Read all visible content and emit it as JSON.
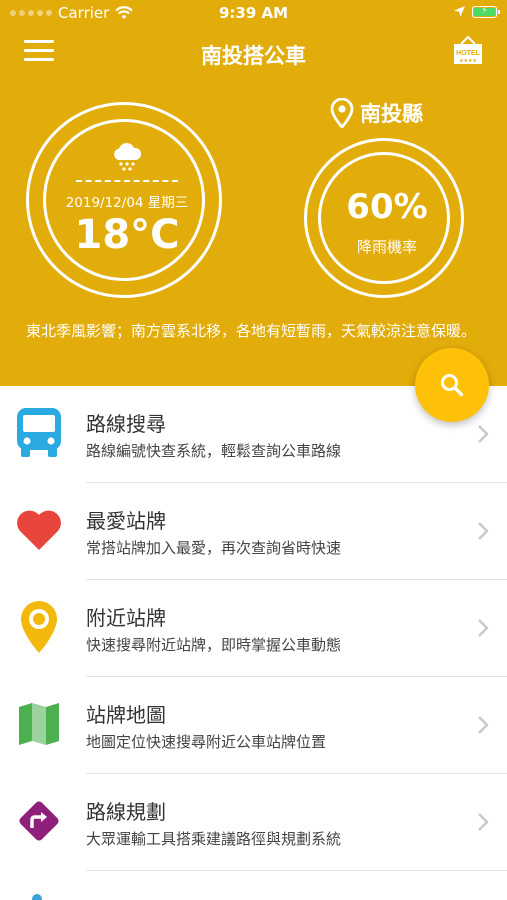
{
  "status_bar": {
    "carrier": "Carrier",
    "time": "9:39 AM"
  },
  "header": {
    "title": "南投搭公車",
    "hotel_icon": "hotel-sign-icon"
  },
  "weather": {
    "date": "2019/12/04 星期三",
    "temperature": "18°C",
    "icon": "rain-cloud-icon"
  },
  "location": {
    "name": "南投縣",
    "icon": "location-pin-icon"
  },
  "rain": {
    "percent": "60%",
    "label": "降雨機率"
  },
  "forecast_text": "東北季風影響；南方雲系北移，各地有短暫雨，天氣較涼注意保暖。",
  "search_button": {
    "icon": "search-icon"
  },
  "menu": [
    {
      "title": "路線搜尋",
      "desc": "路線編號快查系統，輕鬆查詢公車路線",
      "icon": "bus-icon",
      "color": "#29ABE2"
    },
    {
      "title": "最愛站牌",
      "desc": "常搭站牌加入最愛，再次查詢省時快速",
      "icon": "heart-icon",
      "color": "#E8453C"
    },
    {
      "title": "附近站牌",
      "desc": "快速搜尋附近站牌，即時掌握公車動態",
      "icon": "location-pin-icon",
      "color": "#F2B90C"
    },
    {
      "title": "站牌地圖",
      "desc": "地圖定位快速搜尋附近公車站牌位置",
      "icon": "map-icon",
      "color": "#4CAF50"
    },
    {
      "title": "路線規劃",
      "desc": "大眾運輸工具搭乘建議路徑與規劃系統",
      "icon": "route-sign-icon",
      "color": "#8E1F7A"
    }
  ],
  "colors": {
    "header_bg": "#E2AC0B",
    "fab_bg": "#FFC107"
  }
}
